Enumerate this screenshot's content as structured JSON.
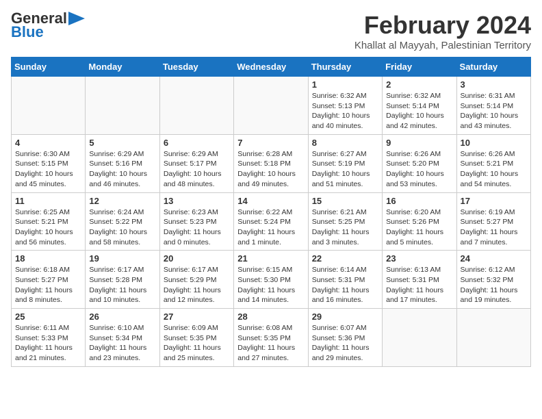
{
  "header": {
    "logo_line1": "General",
    "logo_line2": "Blue",
    "main_title": "February 2024",
    "subtitle": "Khallat al Mayyah, Palestinian Territory"
  },
  "calendar": {
    "days_of_week": [
      "Sunday",
      "Monday",
      "Tuesday",
      "Wednesday",
      "Thursday",
      "Friday",
      "Saturday"
    ],
    "weeks": [
      [
        {
          "day": "",
          "info": ""
        },
        {
          "day": "",
          "info": ""
        },
        {
          "day": "",
          "info": ""
        },
        {
          "day": "",
          "info": ""
        },
        {
          "day": "1",
          "info": "Sunrise: 6:32 AM\nSunset: 5:13 PM\nDaylight: 10 hours\nand 40 minutes."
        },
        {
          "day": "2",
          "info": "Sunrise: 6:32 AM\nSunset: 5:14 PM\nDaylight: 10 hours\nand 42 minutes."
        },
        {
          "day": "3",
          "info": "Sunrise: 6:31 AM\nSunset: 5:14 PM\nDaylight: 10 hours\nand 43 minutes."
        }
      ],
      [
        {
          "day": "4",
          "info": "Sunrise: 6:30 AM\nSunset: 5:15 PM\nDaylight: 10 hours\nand 45 minutes."
        },
        {
          "day": "5",
          "info": "Sunrise: 6:29 AM\nSunset: 5:16 PM\nDaylight: 10 hours\nand 46 minutes."
        },
        {
          "day": "6",
          "info": "Sunrise: 6:29 AM\nSunset: 5:17 PM\nDaylight: 10 hours\nand 48 minutes."
        },
        {
          "day": "7",
          "info": "Sunrise: 6:28 AM\nSunset: 5:18 PM\nDaylight: 10 hours\nand 49 minutes."
        },
        {
          "day": "8",
          "info": "Sunrise: 6:27 AM\nSunset: 5:19 PM\nDaylight: 10 hours\nand 51 minutes."
        },
        {
          "day": "9",
          "info": "Sunrise: 6:26 AM\nSunset: 5:20 PM\nDaylight: 10 hours\nand 53 minutes."
        },
        {
          "day": "10",
          "info": "Sunrise: 6:26 AM\nSunset: 5:21 PM\nDaylight: 10 hours\nand 54 minutes."
        }
      ],
      [
        {
          "day": "11",
          "info": "Sunrise: 6:25 AM\nSunset: 5:21 PM\nDaylight: 10 hours\nand 56 minutes."
        },
        {
          "day": "12",
          "info": "Sunrise: 6:24 AM\nSunset: 5:22 PM\nDaylight: 10 hours\nand 58 minutes."
        },
        {
          "day": "13",
          "info": "Sunrise: 6:23 AM\nSunset: 5:23 PM\nDaylight: 11 hours\nand 0 minutes."
        },
        {
          "day": "14",
          "info": "Sunrise: 6:22 AM\nSunset: 5:24 PM\nDaylight: 11 hours\nand 1 minute."
        },
        {
          "day": "15",
          "info": "Sunrise: 6:21 AM\nSunset: 5:25 PM\nDaylight: 11 hours\nand 3 minutes."
        },
        {
          "day": "16",
          "info": "Sunrise: 6:20 AM\nSunset: 5:26 PM\nDaylight: 11 hours\nand 5 minutes."
        },
        {
          "day": "17",
          "info": "Sunrise: 6:19 AM\nSunset: 5:27 PM\nDaylight: 11 hours\nand 7 minutes."
        }
      ],
      [
        {
          "day": "18",
          "info": "Sunrise: 6:18 AM\nSunset: 5:27 PM\nDaylight: 11 hours\nand 8 minutes."
        },
        {
          "day": "19",
          "info": "Sunrise: 6:17 AM\nSunset: 5:28 PM\nDaylight: 11 hours\nand 10 minutes."
        },
        {
          "day": "20",
          "info": "Sunrise: 6:17 AM\nSunset: 5:29 PM\nDaylight: 11 hours\nand 12 minutes."
        },
        {
          "day": "21",
          "info": "Sunrise: 6:15 AM\nSunset: 5:30 PM\nDaylight: 11 hours\nand 14 minutes."
        },
        {
          "day": "22",
          "info": "Sunrise: 6:14 AM\nSunset: 5:31 PM\nDaylight: 11 hours\nand 16 minutes."
        },
        {
          "day": "23",
          "info": "Sunrise: 6:13 AM\nSunset: 5:31 PM\nDaylight: 11 hours\nand 17 minutes."
        },
        {
          "day": "24",
          "info": "Sunrise: 6:12 AM\nSunset: 5:32 PM\nDaylight: 11 hours\nand 19 minutes."
        }
      ],
      [
        {
          "day": "25",
          "info": "Sunrise: 6:11 AM\nSunset: 5:33 PM\nDaylight: 11 hours\nand 21 minutes."
        },
        {
          "day": "26",
          "info": "Sunrise: 6:10 AM\nSunset: 5:34 PM\nDaylight: 11 hours\nand 23 minutes."
        },
        {
          "day": "27",
          "info": "Sunrise: 6:09 AM\nSunset: 5:35 PM\nDaylight: 11 hours\nand 25 minutes."
        },
        {
          "day": "28",
          "info": "Sunrise: 6:08 AM\nSunset: 5:35 PM\nDaylight: 11 hours\nand 27 minutes."
        },
        {
          "day": "29",
          "info": "Sunrise: 6:07 AM\nSunset: 5:36 PM\nDaylight: 11 hours\nand 29 minutes."
        },
        {
          "day": "",
          "info": ""
        },
        {
          "day": "",
          "info": ""
        }
      ]
    ]
  }
}
